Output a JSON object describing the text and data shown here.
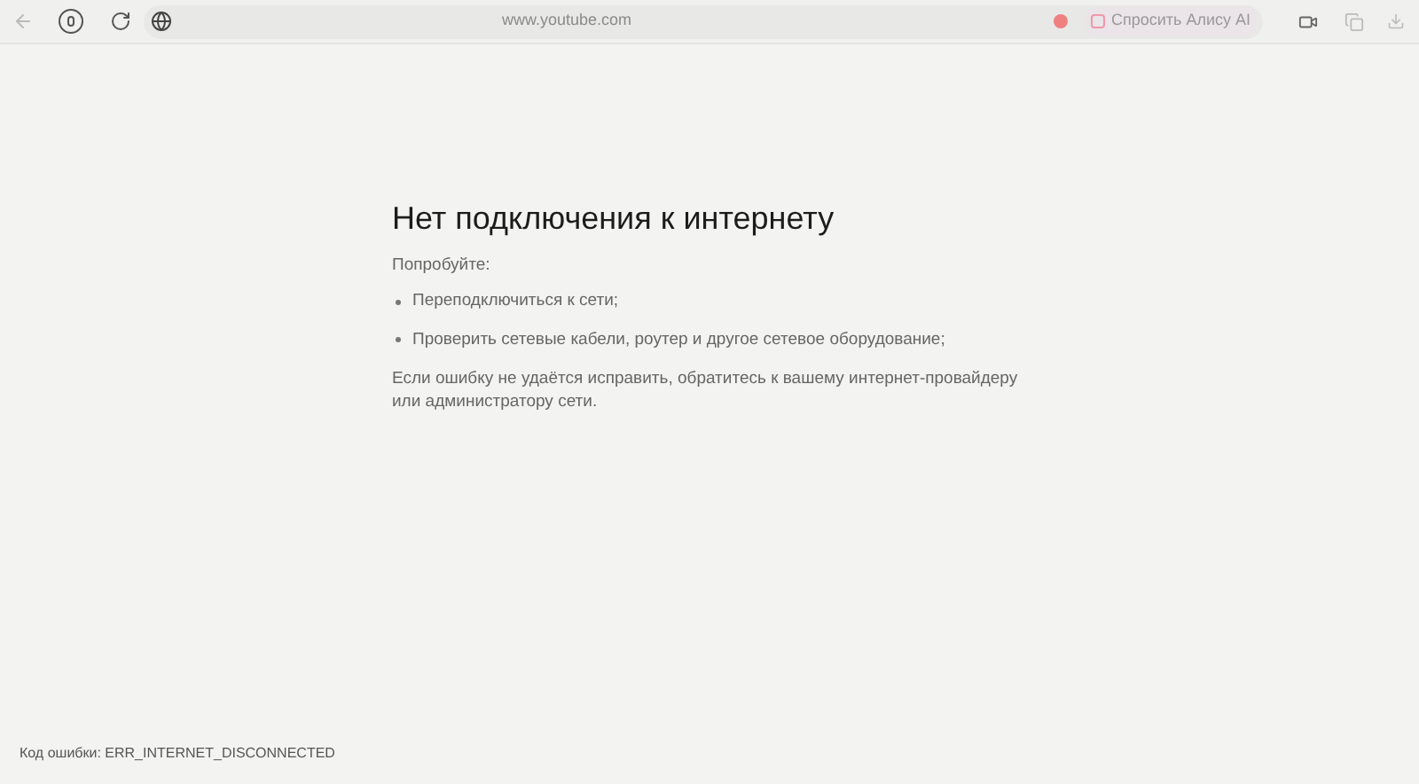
{
  "toolbar": {
    "address": "www.youtube.com",
    "assistant_button": "Спросить Алису AI"
  },
  "error": {
    "title": "Нет подключения к интернету",
    "intro": "Попробуйте:",
    "suggestions": [
      "Переподключиться к сети;",
      "Проверить сетевые кабели, роутер и другое сетевое оборудование;"
    ],
    "note": "Если ошибку не удаётся исправить, обратитесь к вашему интернет-провайдеру или администратору сети."
  },
  "error_code": "Код ошибки: ERR_INTERNET_DISCONNECTED"
}
